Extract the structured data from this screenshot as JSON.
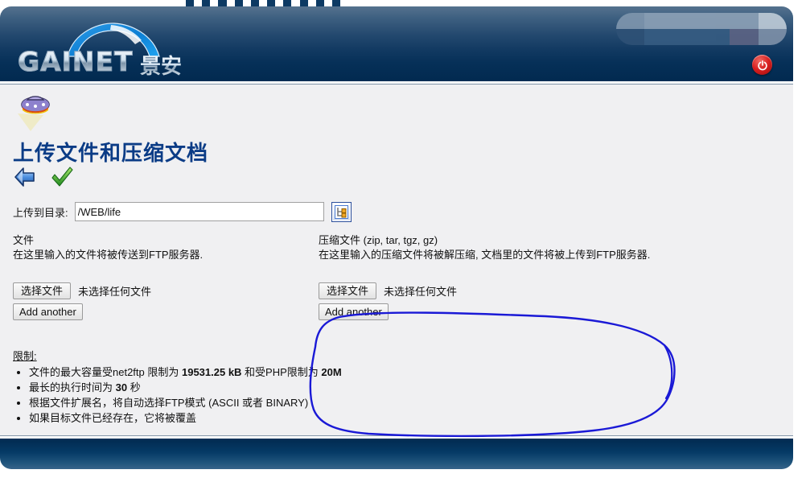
{
  "brand": {
    "wordmark": "GAINET",
    "cn_name": "景安",
    "accent_header_top": "#55728e",
    "accent_header_bottom": "#022a50",
    "power_color": "#d81f1f",
    "title_color": "#0b3c86",
    "annotation_color": "#1a19d6",
    "content_bg": "#f0f0f2"
  },
  "header": {
    "logout_title": "power-button"
  },
  "main": {
    "page_title": "上传文件和压缩文档",
    "back_title": "back",
    "confirm_title": "ok",
    "directory": {
      "label": "上传到目录:",
      "value": "/WEB/life",
      "placeholder": "",
      "browse_title": "browse-directory-tree"
    },
    "files_column": {
      "heading": "文件",
      "description": "在这里输入的文件将被传送到FTP服务器.",
      "choose_label": "选择文件",
      "status": "未选择任何文件",
      "add_another_label": "Add another"
    },
    "archives_column": {
      "heading": "压缩文件 (zip, tar, tgz, gz)",
      "description": "在这里输入的压缩文件将被解压缩, 文档里的文件将被上传到FTP服务器.",
      "choose_label": "选择文件",
      "status": "未选择任何文件",
      "add_another_label": "Add another"
    },
    "restrictions": {
      "title": "限制:",
      "items": [
        "文件的最大容量受net2ftp 限制为 19531.25 kB 和受PHP限制为 20M",
        "最长的执行时间为 30 秒",
        "根据文件扩展名，将自动选择FTP模式 (ASCII 或者 BINARY)",
        "如果目标文件已经存在，它将被覆盖"
      ],
      "item0_parts": {
        "a": "文件的最大容量受net2ftp 限制为 ",
        "b": "19531.25 kB",
        "c": " 和受PHP限制为 ",
        "d": "20M"
      },
      "item1_parts": {
        "a": "最长的执行时间为 ",
        "b": "30",
        "c": " 秒"
      }
    }
  }
}
